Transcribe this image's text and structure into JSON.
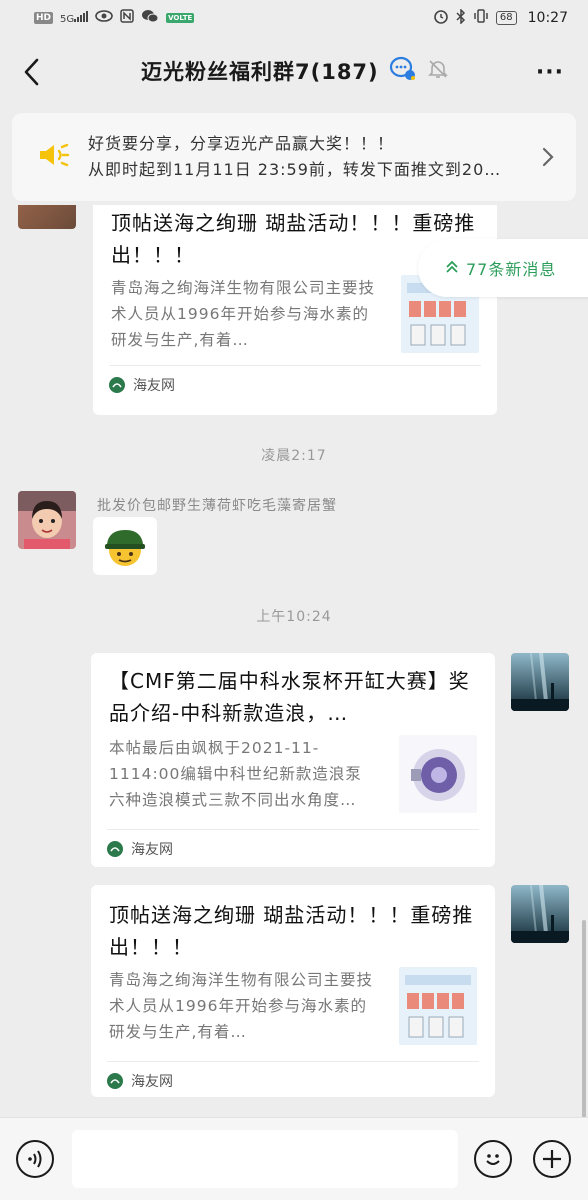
{
  "status_bar": {
    "left_badges": [
      "HD",
      "5G",
      "VOLTE"
    ],
    "battery": "68",
    "time": "10:27"
  },
  "nav": {
    "title": "迈光粉丝福利群7(187)",
    "back_icon": "chevron-left-icon",
    "more_icon": "more-dots-icon",
    "more_label": "···"
  },
  "notice": {
    "line1": "好货要分享，分享迈光产品赢大奖！！！",
    "line2": "从即时起到11月11日 23:59前，转发下面推文到20…",
    "accent": "#f5c20c"
  },
  "new_messages": {
    "label": "77条新消息"
  },
  "messages": [
    {
      "type": "link-card",
      "title": "顶帖送海之绚珊 瑚盐活动！！！重磅推出！！！",
      "desc": "青岛海之绚海洋生物有限公司主要技术人员从1996年开始参与海水素的研发与生产,有着…",
      "source": "海友网"
    },
    {
      "type": "timestamp",
      "text": "凌晨2:17"
    },
    {
      "type": "emoji",
      "sender": "批发价包邮野生薄荷虾吃毛藻寄居蟹",
      "emoji": "soldier-emoji"
    },
    {
      "type": "timestamp",
      "text": "上午10:24"
    },
    {
      "type": "link-card",
      "title": "【CMF第二届中科水泵杯开缸大赛】奖品介绍-中科新款造浪，…",
      "desc": "本帖最后由飒枫于2021-11-1114:00编辑中科世纪新款造浪泵六种造浪模式三款不同出水角度…",
      "source": "海友网"
    },
    {
      "type": "link-card",
      "title": "顶帖送海之绚珊 瑚盐活动！！！重磅推出！！！",
      "desc": "青岛海之绚海洋生物有限公司主要技术人员从1996年开始参与海水素的研发与生产,有着…",
      "source": "海友网"
    }
  ],
  "input_bar": {
    "voice_icon": "voice-icon",
    "emoji_icon": "smiley-icon",
    "plus_icon": "plus-icon",
    "placeholder": ""
  }
}
